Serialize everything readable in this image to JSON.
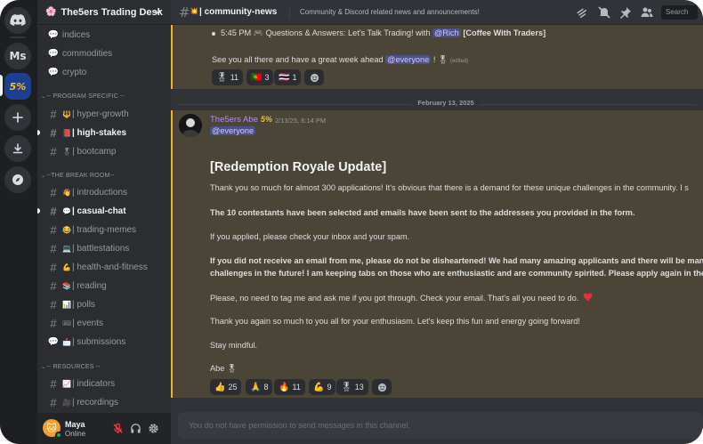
{
  "server_rail": {
    "servers": [
      {
        "name": "discord-home-icon",
        "label": ""
      },
      {
        "name": "server-ms",
        "label": "Ms"
      },
      {
        "name": "server-the5ers",
        "label": "5%"
      },
      {
        "name": "add-server-icon",
        "label": ""
      },
      {
        "name": "download-apps-icon",
        "label": ""
      },
      {
        "name": "explore-icon",
        "label": ""
      }
    ]
  },
  "sidebar": {
    "guild_name": "The5ers Trading Desk",
    "channels_top": [
      {
        "label": "indices",
        "icon": "forum-icon"
      },
      {
        "label": "commodities",
        "icon": "forum-icon"
      },
      {
        "label": "crypto",
        "icon": "forum-icon"
      }
    ],
    "categories": [
      {
        "label": "-- PROGRAM SPECIFIC --",
        "channels": [
          {
            "emoji": "🔱",
            "label": "| hyper-growth",
            "unread": false
          },
          {
            "emoji": "📕",
            "label": "| high-stakes",
            "unread": true
          },
          {
            "emoji": "🎖",
            "label": "| bootcamp",
            "unread": false
          }
        ]
      },
      {
        "label": "--THE BREAK ROOM--",
        "channels": [
          {
            "emoji": "👋",
            "label": "| introductions",
            "unread": false
          },
          {
            "emoji": "💬",
            "label": "| casual-chat",
            "unread": true
          },
          {
            "emoji": "😂",
            "label": "| trading-memes",
            "unread": false
          },
          {
            "emoji": "💻",
            "label": "| battlestations",
            "unread": false
          },
          {
            "emoji": "💪",
            "label": "| health-and-fitness",
            "unread": false
          },
          {
            "emoji": "📚",
            "label": "| reading",
            "unread": false
          },
          {
            "emoji": "📊",
            "label": "| polls",
            "unread": false
          },
          {
            "emoji": "🎟",
            "label": "| events",
            "unread": false
          },
          {
            "emoji": "📩",
            "label": "| submissions",
            "unread": false
          }
        ]
      },
      {
        "label": "-- RESOURCES --",
        "channels": [
          {
            "emoji": "📈",
            "label": "| indicators",
            "unread": false
          },
          {
            "emoji": "🎥",
            "label": "| recordings",
            "unread": false
          }
        ]
      }
    ],
    "user": {
      "name": "Maya",
      "status": "Online"
    }
  },
  "topbar": {
    "channel_emoji": "💥",
    "channel_name": "| community-news",
    "topic": "Community & Discord related news and announcements!",
    "search_placeholder": "Search"
  },
  "messages": {
    "prev": {
      "bullet_time": "5:45 PM",
      "bullet_text": "Questions & Answers: Let's Talk Trading! with",
      "bullet_mention": "@Rich",
      "bullet_bold": "[Coffee With Traders]",
      "closing_pre": "See you all there and have a great week ahead",
      "closing_mention": "@everyone",
      "closing_post": "!",
      "edited": "(edited)",
      "reactions": [
        {
          "emoji": "🎖",
          "count": "11"
        },
        {
          "emoji": "🇵🇹",
          "count": "3"
        },
        {
          "emoji": "🇹🇭",
          "count": "1"
        }
      ]
    },
    "date_divider": "February 13, 2025",
    "main": {
      "author": "The5ers Abe",
      "author_badge": "5%",
      "timestamp": "2/13/25, 6:14 PM",
      "mention": "@everyone",
      "heading": "[Redemption Royale Update]",
      "p1": "Thank you so much for almost 300 applications! It's obvious that there is a demand for these unique challenges in the community. I s",
      "p2": "The 10 contestants have been selected and emails have been sent to the addresses you provided in the form.",
      "p3": "If you applied, please check your inbox and your spam.",
      "p4a": "If you did not receive an email from me, please do not be disheartened! We had many amazing applicants and there will be many",
      "p4b": "challenges in the future! I am keeping tabs on those who are enthusiastic and are community spirited. Please apply again in the",
      "p5": "Please, no need to tag me and ask me if you got through. Check your email. That's all you need to do.",
      "p6": "Thank you again so much to you all for your enthusiasm. Let's keep this fun and energy going forward!",
      "p7": "Stay mindful.",
      "sign": "Abe",
      "reactions": [
        {
          "emoji": "👍",
          "count": "25"
        },
        {
          "emoji": "🙏",
          "count": "8"
        },
        {
          "emoji": "🔥",
          "count": "11"
        },
        {
          "emoji": "💪",
          "count": "9"
        },
        {
          "emoji": "🎖",
          "count": "13"
        }
      ]
    }
  },
  "composer": {
    "placeholder": "You do not have permission to send messages in this channel."
  },
  "colors": {
    "mention_bg": "#4e5089",
    "highlight_bg": "#4a4536",
    "online": "#23a55a",
    "author": "#b38ef0"
  }
}
